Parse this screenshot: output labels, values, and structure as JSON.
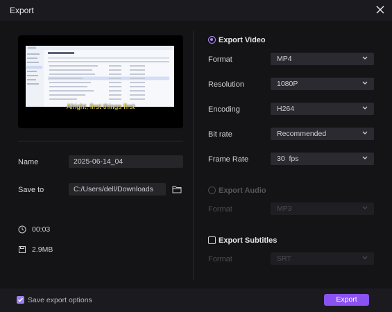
{
  "window": {
    "title": "Export"
  },
  "preview": {
    "subtitle": "Alright, first things first"
  },
  "left": {
    "name_label": "Name",
    "name_value": "2025-06-14_04",
    "save_to_label": "Save to",
    "save_to_value": "C:/Users/dell/Downloads",
    "duration": "00:03",
    "size": "2.9MB"
  },
  "export_video": {
    "label": "Export Video",
    "selected": true,
    "rows": [
      {
        "label": "Format",
        "value": "MP4"
      },
      {
        "label": "Resolution",
        "value": "1080P"
      },
      {
        "label": "Encoding",
        "value": "H264"
      },
      {
        "label": "Bit rate",
        "value": "Recommended"
      },
      {
        "label": "Frame Rate",
        "value": "30  fps"
      }
    ]
  },
  "export_audio": {
    "label": "Export Audio",
    "selected": false,
    "format_label": "Format",
    "format_value": "MP3"
  },
  "export_subtitles": {
    "label": "Export Subtitles",
    "checked": false,
    "format_label": "Format",
    "format_value": "SRT"
  },
  "footer": {
    "save_options_label": "Save export options",
    "save_options_checked": true,
    "export_label": "Export"
  },
  "colors": {
    "accent": "#8a52f0",
    "radio_accent": "#a88bf5",
    "subtitle_text": "#e8d34a",
    "background": "#141417"
  },
  "icons": [
    "close-icon",
    "folder-icon",
    "clock-icon",
    "file-size-icon",
    "chevron-down-icon"
  ]
}
